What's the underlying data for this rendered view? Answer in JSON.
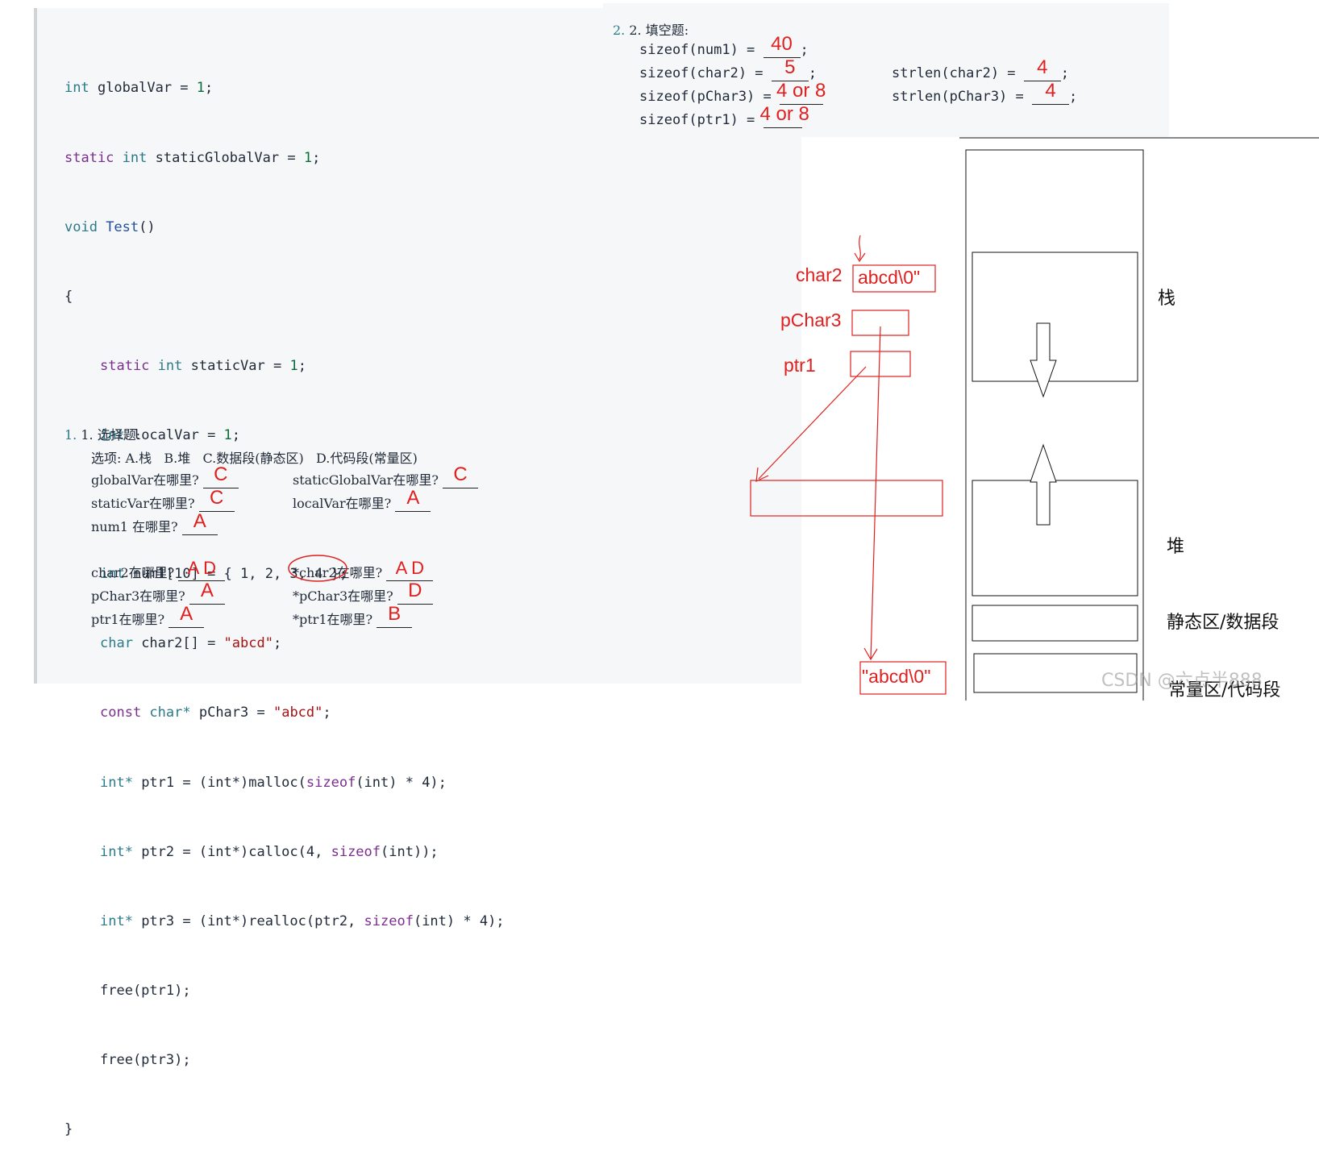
{
  "code": {
    "line1": {
      "kw": "int",
      "rest": " globalVar = ",
      "num": "1",
      "end": ";"
    },
    "line2": {
      "kw": "static",
      "ty": " int",
      "rest": " staticGlobalVar = ",
      "num": "1",
      "end": ";"
    },
    "line3": {
      "kw": "void",
      "fn": " Test",
      "rest": "()"
    },
    "line4": "{",
    "line5": {
      "kw": "static",
      "ty": " int",
      "rest": " staticVar = ",
      "num": "1",
      "end": ";"
    },
    "line6": {
      "ty": "int",
      "rest": " localVar = ",
      "num": "1",
      "end": ";"
    },
    "line7": {
      "ty": "int",
      "rest": " num1[10] = { 1, 2, 3, 4 };"
    },
    "line8": {
      "ty": "char",
      "rest": " char2[] = ",
      "str": "\"abcd\"",
      "end": ";"
    },
    "line9": {
      "kw": "const",
      "ty": " char*",
      "rest": " pChar3 = ",
      "str": "\"abcd\"",
      "end": ";"
    },
    "line10": {
      "ty": "int*",
      "rest": " ptr1 = (int*)malloc(",
      "kw": "sizeof",
      "rest2": "(int) * 4);"
    },
    "line11": {
      "ty": "int*",
      "rest": " ptr2 = (int*)calloc(4, ",
      "kw": "sizeof",
      "rest2": "(int));"
    },
    "line12": {
      "ty": "int*",
      "rest": " ptr3 = (int*)realloc(ptr2, ",
      "kw": "sizeof",
      "rest2": "(int) * 4);"
    },
    "line13": "free(ptr1);",
    "line14": "free(ptr3);",
    "line15": "}"
  },
  "q1": {
    "title": "1. 选择题:",
    "options": "选项: A.栈   B.堆   C.数据段(静态区)   D.代码段(常量区)",
    "items": [
      {
        "label": "globalVar在哪里?",
        "answer": "C"
      },
      {
        "label": "staticGlobalVar在哪里?",
        "answer": "C"
      },
      {
        "label": "staticVar在哪里?",
        "answer": "C"
      },
      {
        "label": "localVar在哪里?",
        "answer": "A"
      },
      {
        "label": "num1 在哪里?",
        "answer": "A"
      },
      {
        "label": "char2在哪里?",
        "answer": "A D"
      },
      {
        "label": "*char2在哪里?",
        "answer": "A D"
      },
      {
        "label": "pChar3在哪里?",
        "answer": "A"
      },
      {
        "label": "*pChar3在哪里?",
        "answer": "D"
      },
      {
        "label": "ptr1在哪里?",
        "answer": "A"
      },
      {
        "label": "*ptr1在哪里?",
        "answer": "B"
      }
    ]
  },
  "q2": {
    "title": "2. 填空题:",
    "items": [
      {
        "label": "sizeof(num1) = ",
        "answer": "40"
      },
      {
        "label": "sizeof(char2) = ",
        "answer": "5"
      },
      {
        "label": "strlen(char2) = ",
        "answer": "4"
      },
      {
        "label": "sizeof(pChar3) = ",
        "answer": "4 or 8"
      },
      {
        "label": "strlen(pChar3) = ",
        "answer": "4"
      },
      {
        "label": "sizeof(ptr1) = ",
        "answer": "4 or 8"
      }
    ]
  },
  "diagram": {
    "var_char2": "char2",
    "char2_content": "abcd\\0\"",
    "var_pchar3": "pChar3",
    "var_ptr1": "ptr1",
    "literal": "\"abcd\\0\"",
    "region_stack": "栈",
    "region_heap": "堆",
    "region_static": "静态区/数据段",
    "region_const": "常量区/代码段"
  },
  "watermark": "CSDN @六点半888",
  "colors": {
    "annotation": "#e0201e",
    "panel": "#f6f7f9"
  }
}
